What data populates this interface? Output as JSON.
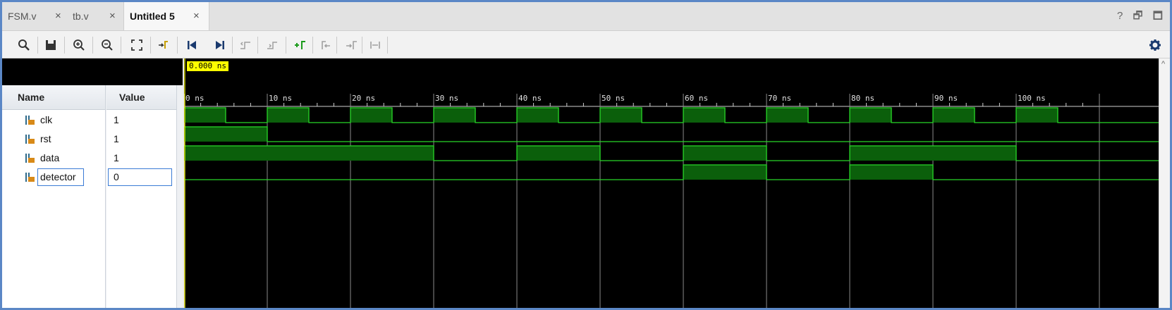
{
  "tabs": [
    {
      "label": "FSM.v",
      "close": "×",
      "active": false
    },
    {
      "label": "tb.v",
      "close": "×",
      "active": false
    },
    {
      "label": "Untitled 5",
      "close": "×",
      "active": true
    }
  ],
  "window_controls": {
    "help": "?",
    "restore": "🗗",
    "maximize": "🗖"
  },
  "toolbar": [
    "search-icon",
    "save-icon",
    "zoom-in-icon",
    "zoom-out-icon",
    "zoom-fit-icon",
    "go-to-cursor-icon",
    "go-to-start-icon",
    "go-to-end-icon",
    "previous-transition-icon",
    "next-transition-icon",
    "add-marker-icon",
    "previous-marker-icon",
    "next-marker-icon",
    "swap-cursors-icon",
    "settings-gear-icon"
  ],
  "columns": {
    "name": "Name",
    "value": "Value"
  },
  "signals": [
    {
      "name": "clk",
      "value": "1"
    },
    {
      "name": "rst",
      "value": "1"
    },
    {
      "name": "data",
      "value": "1"
    },
    {
      "name": "detector",
      "value": "0"
    }
  ],
  "cursor": {
    "time_label": "0.000 ns"
  },
  "timeline": {
    "labels": [
      "0 ns",
      "10 ns",
      "20 ns",
      "30 ns",
      "40 ns",
      "50 ns",
      "60 ns",
      "70 ns",
      "80 ns",
      "90 ns",
      "100 ns"
    ],
    "max_ns": 110
  },
  "waveforms": {
    "clk": [
      [
        0,
        1
      ],
      [
        5,
        0
      ],
      [
        10,
        1
      ],
      [
        15,
        0
      ],
      [
        20,
        1
      ],
      [
        25,
        0
      ],
      [
        30,
        1
      ],
      [
        35,
        0
      ],
      [
        40,
        1
      ],
      [
        45,
        0
      ],
      [
        50,
        1
      ],
      [
        55,
        0
      ],
      [
        60,
        1
      ],
      [
        65,
        0
      ],
      [
        70,
        1
      ],
      [
        75,
        0
      ],
      [
        80,
        1
      ],
      [
        85,
        0
      ],
      [
        90,
        1
      ],
      [
        95,
        0
      ],
      [
        100,
        1
      ],
      [
        105,
        0
      ]
    ],
    "rst": [
      [
        0,
        1
      ],
      [
        10,
        0
      ]
    ],
    "data": [
      [
        0,
        1
      ],
      [
        30,
        0
      ],
      [
        40,
        1
      ],
      [
        50,
        0
      ],
      [
        60,
        1
      ],
      [
        70,
        0
      ],
      [
        80,
        1
      ],
      [
        100,
        0
      ]
    ],
    "detector": [
      [
        0,
        0
      ],
      [
        60,
        1
      ],
      [
        70,
        0
      ],
      [
        80,
        1
      ],
      [
        90,
        0
      ]
    ]
  },
  "colors": {
    "wave": "#28d628",
    "fill": "#0b5f0b",
    "grid": "#8a8a8a",
    "cursor": "#ffff00",
    "selection": "#3a7bd5"
  }
}
